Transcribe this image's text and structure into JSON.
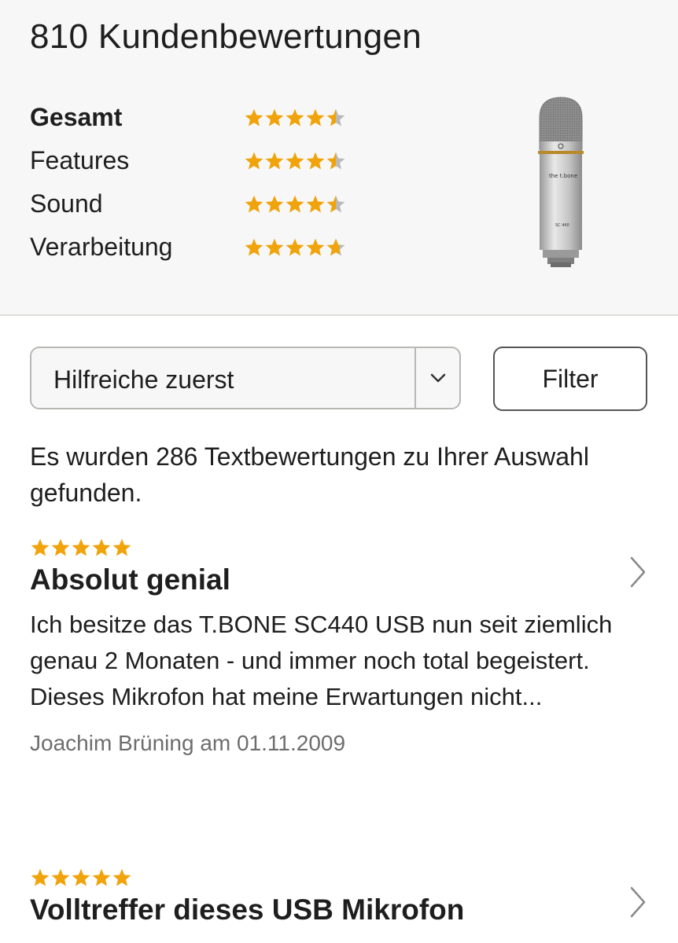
{
  "summary": {
    "title": "810 Kundenbewertungen",
    "ratings": [
      {
        "label": "Gesamt",
        "stars": 4.5
      },
      {
        "label": "Features",
        "stars": 4.5
      },
      {
        "label": "Sound",
        "stars": 4.5
      },
      {
        "label": "Verarbeitung",
        "stars": 4.7
      }
    ],
    "product_image": {
      "brand_text": "the t.bone",
      "model_text": "SC 440"
    }
  },
  "controls": {
    "sort_value": "Hilfreiche zuerst",
    "filter_label": "Filter"
  },
  "result_count": "Es wurden 286 Textbewertungen zu Ihrer Auswahl gefunden.",
  "reviews": [
    {
      "stars": 5,
      "title": "Absolut genial",
      "body": "Ich besitze das T.BONE SC440 USB nun seit ziemlich genau 2 Monaten - und immer noch total begeistert. Dieses Mikrofon hat meine Erwartungen nicht...",
      "meta": "Joachim Brüning am 01.11.2009"
    },
    {
      "stars": 5,
      "title": "Volltreffer dieses USB Mikrofon",
      "body": "",
      "meta": ""
    }
  ],
  "colors": {
    "star_filled": "#f0a30a",
    "star_empty": "#b9b9b9",
    "summary_bg": "#f7f7f7"
  },
  "icons": {
    "sort_chevron": "chevron-down-icon",
    "review_arrow": "chevron-right-icon"
  }
}
